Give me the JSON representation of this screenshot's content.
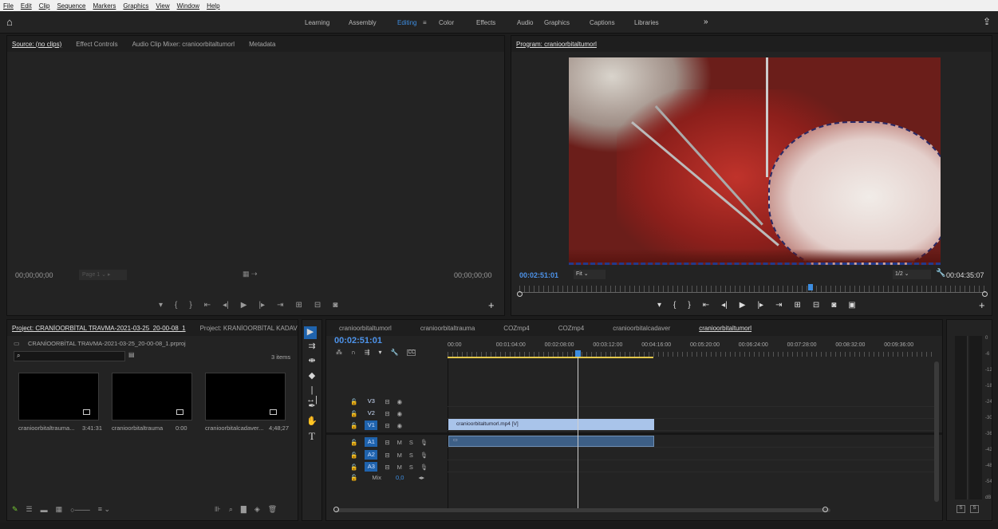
{
  "menu": [
    "File",
    "Edit",
    "Clip",
    "Sequence",
    "Markers",
    "Graphics",
    "View",
    "Window",
    "Help"
  ],
  "workspaces": [
    "Learning",
    "Assembly",
    "Editing",
    "Color",
    "Effects",
    "Audio",
    "Graphics",
    "Captions",
    "Libraries"
  ],
  "active_workspace": "Editing",
  "more_workspaces_glyph": "»",
  "source": {
    "tabs": [
      "Source: (no clips)",
      "Effect Controls",
      "Audio Clip Mixer: cranioorbitaltumorl",
      "Metadata"
    ],
    "tc_left": "00;00;00;00",
    "page_select": "Page 1",
    "tc_right": "00;00;00;00"
  },
  "program": {
    "title": "Program: cranioorbitaltumorl",
    "tc_current": "00:02:51:01",
    "fit": "Fit",
    "resolution": "1/2",
    "tc_duration": "00:04:35:07"
  },
  "project": {
    "tabs": [
      "Project: CRANİOORBİTAL TRAVMA-2021-03-25_20-00-08_1",
      "Project: KRANİOORBİTAL KADAVR"
    ],
    "file": "CRANİOORBİTAL TRAVMA-2021-03-25_20-00-08_1.prproj",
    "item_count": "3 items",
    "items": [
      {
        "name": "cranioorbitaltrauma...",
        "dur": "3:41:31"
      },
      {
        "name": "cranioorbitaltrauma",
        "dur": "0:00"
      },
      {
        "name": "cranioorbitalcadaver...",
        "dur": "4;48;27"
      }
    ]
  },
  "timeline": {
    "tabs": [
      "cranioorbitaltumorl",
      "cranioorbitaltrauma",
      "COZmp4",
      "COZmp4",
      "cranioorbitalcadaver",
      "cranioorbitaltumorl"
    ],
    "timecode": "00:02:51:01",
    "ruler": [
      "00:00",
      "00:01:04:00",
      "00:02:08:00",
      "00:03:12:00",
      "00:04:16:00",
      "00:05:20:00",
      "00:06:24:00",
      "00:07:28:00",
      "00:08:32:00",
      "00:09:36:00"
    ],
    "tracks": [
      {
        "name": "V3",
        "kind": "video"
      },
      {
        "name": "V2",
        "kind": "video"
      },
      {
        "name": "V1",
        "kind": "video"
      },
      {
        "name": "A1",
        "kind": "audio"
      },
      {
        "name": "A2",
        "kind": "audio"
      },
      {
        "name": "A3",
        "kind": "audio"
      }
    ],
    "mix_label": "Mix",
    "mix_value": "0,0",
    "clip_label": "cranioorbitaltumorl.mp4 [V]",
    "playhead_fraction": 0.266,
    "clip_end_fraction": 0.425
  },
  "meter": {
    "labels": [
      "0",
      "-6",
      "-12",
      "-18",
      "-24",
      "-30",
      "-36",
      "-42",
      "-48",
      "-54",
      "dB"
    ],
    "solo": [
      "S",
      "S"
    ]
  },
  "colors": {
    "accent": "#3d8de0",
    "clip_video": "#a9c4ea",
    "clip_audio": "#3d5f86",
    "track_blue": "#1f63ad"
  }
}
